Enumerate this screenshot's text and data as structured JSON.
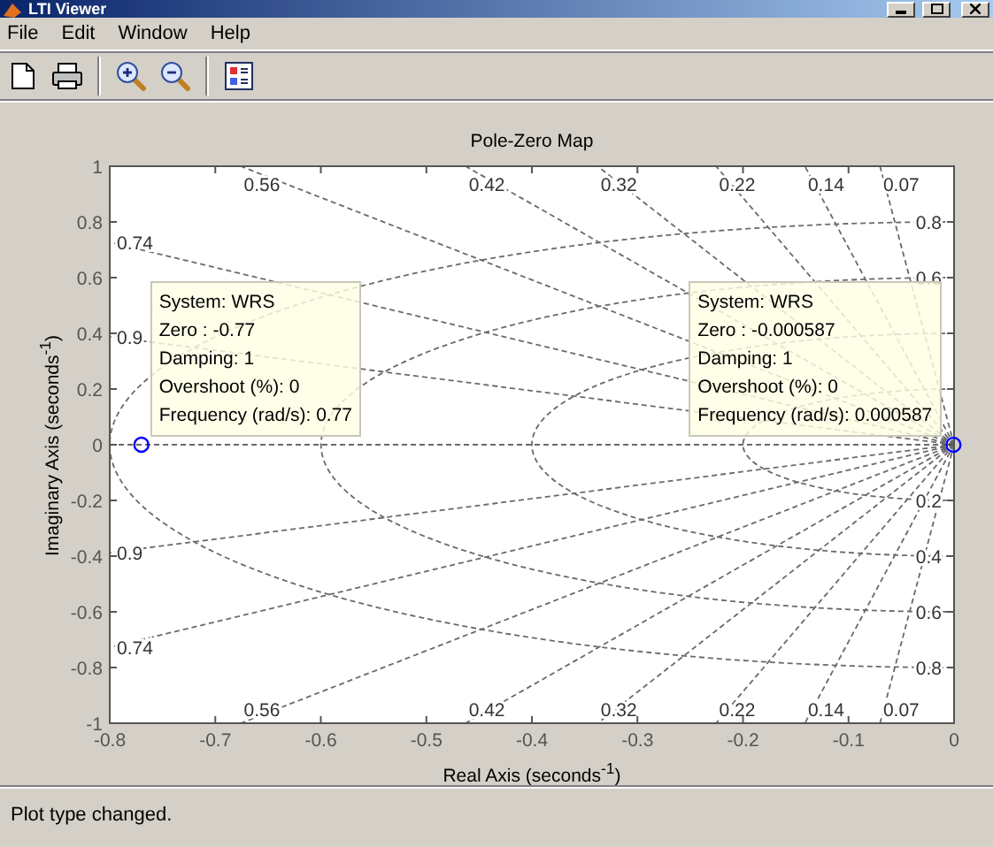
{
  "window": {
    "title": "LTI Viewer"
  },
  "menu": [
    "File",
    "Edit",
    "Window",
    "Help"
  ],
  "plot": {
    "chart_data": {
      "type": "scatter",
      "title": "Pole-Zero Map",
      "xlabel": "Real Axis (seconds$^{-1}$)",
      "ylabel": "Imaginary Axis (seconds$^{-1}$)",
      "x": [
        -0.77,
        -0.000587
      ],
      "series": [
        {
          "color": "#0000ff",
          "values": [
            0,
            0
          ]
        }
      ],
      "xlim": [
        -0.8,
        0
      ],
      "ylim": [
        -1,
        1
      ],
      "xticks": [
        -0.8,
        -0.7,
        -0.6,
        -0.5,
        -0.4,
        -0.3,
        -0.2,
        -0.1,
        0
      ],
      "yticks": [
        1,
        0.8,
        0.6,
        0.4,
        0.2,
        0,
        -0.2,
        -0.4,
        -0.6,
        -0.8,
        -1
      ],
      "grid": true
    },
    "grid_labels": {
      "upper_damping": [
        "0.9",
        "0.74",
        "0.56",
        "0.42",
        "0.32",
        "0.22",
        "0.14",
        "0.07"
      ],
      "upper_frequency": [
        "0.8",
        "0.6"
      ],
      "lower_frequency": [
        "0.2",
        "0.4",
        "0.6",
        "0.8"
      ],
      "lower_damping": [
        "0.9",
        "0.74",
        "0.56",
        "0.42",
        "0.32",
        "0.22",
        "0.14",
        "0.07"
      ]
    },
    "data_tips": [
      {
        "lines": [
          "System: WRS",
          "Zero : -0.77",
          "Damping: 1",
          "Overshoot (%): 0",
          "Frequency (rad/s): 0.77"
        ]
      },
      {
        "lines": [
          "System: WRS",
          "Zero : -0.000587",
          "Damping: 1",
          "Overshoot (%): 0",
          "Frequency (rad/s): 0.000587"
        ]
      }
    ]
  },
  "status_bar": "Plot type changed."
}
